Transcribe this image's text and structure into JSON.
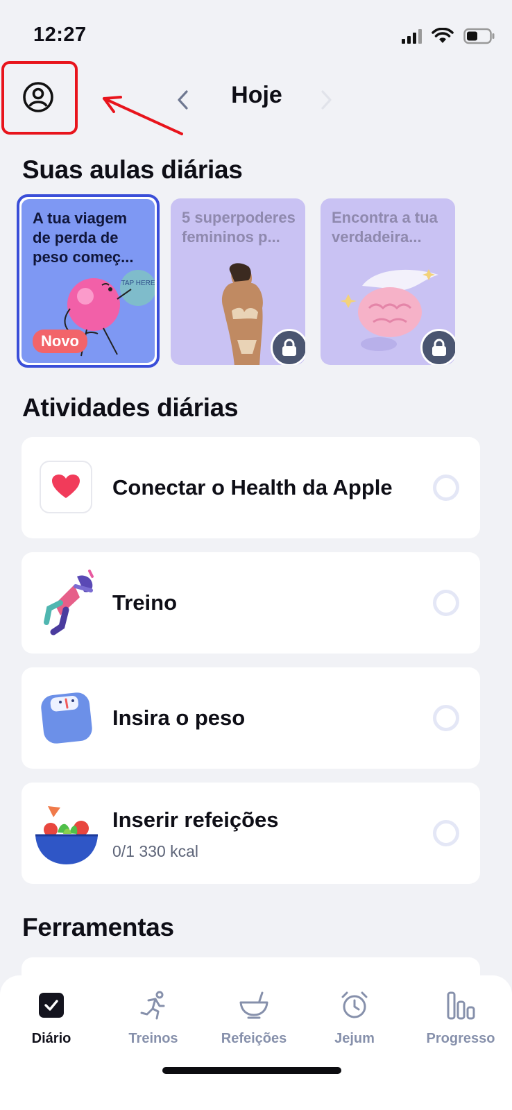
{
  "status_bar": {
    "time": "12:27"
  },
  "header": {
    "title": "Hoje"
  },
  "lessons_section": {
    "title": "Suas aulas diárias",
    "cards": [
      {
        "title": "A tua viagem de perda de peso começ...",
        "badge": "Novo",
        "sticker_text": "TAP HERE",
        "locked": false
      },
      {
        "title": "5 superpoderes femininos p...",
        "locked": true
      },
      {
        "title": "Encontra a tua verdadeira...",
        "locked": true
      }
    ]
  },
  "activities_section": {
    "title": "Atividades diárias",
    "items": [
      {
        "label": "Conectar o Health da Apple",
        "icon": "heart-icon"
      },
      {
        "label": "Treino",
        "icon": "workout-illustration"
      },
      {
        "label": "Insira o peso",
        "icon": "scale-illustration"
      },
      {
        "label": "Inserir refeições",
        "sub": "0/1 330 kcal",
        "icon": "salad-bowl-illustration"
      }
    ]
  },
  "tools_section": {
    "title": "Ferramentas"
  },
  "tabbar": {
    "tabs": [
      {
        "label": "Diário",
        "icon": "diary-check-icon",
        "active": true
      },
      {
        "label": "Treinos",
        "icon": "running-icon"
      },
      {
        "label": "Refeições",
        "icon": "bowl-icon"
      },
      {
        "label": "Jejum",
        "icon": "alarm-clock-icon"
      },
      {
        "label": "Progresso",
        "icon": "bar-chart-icon"
      }
    ]
  },
  "colors": {
    "background": "#F1F2F6",
    "active_card_border": "#3A4ED8",
    "active_card_bg": "#7E98F3",
    "locked_card_bg": "#C9C2F3",
    "badge": "#F2646A",
    "annotation": "#E8141C",
    "tab_inactive": "#8690AB"
  }
}
